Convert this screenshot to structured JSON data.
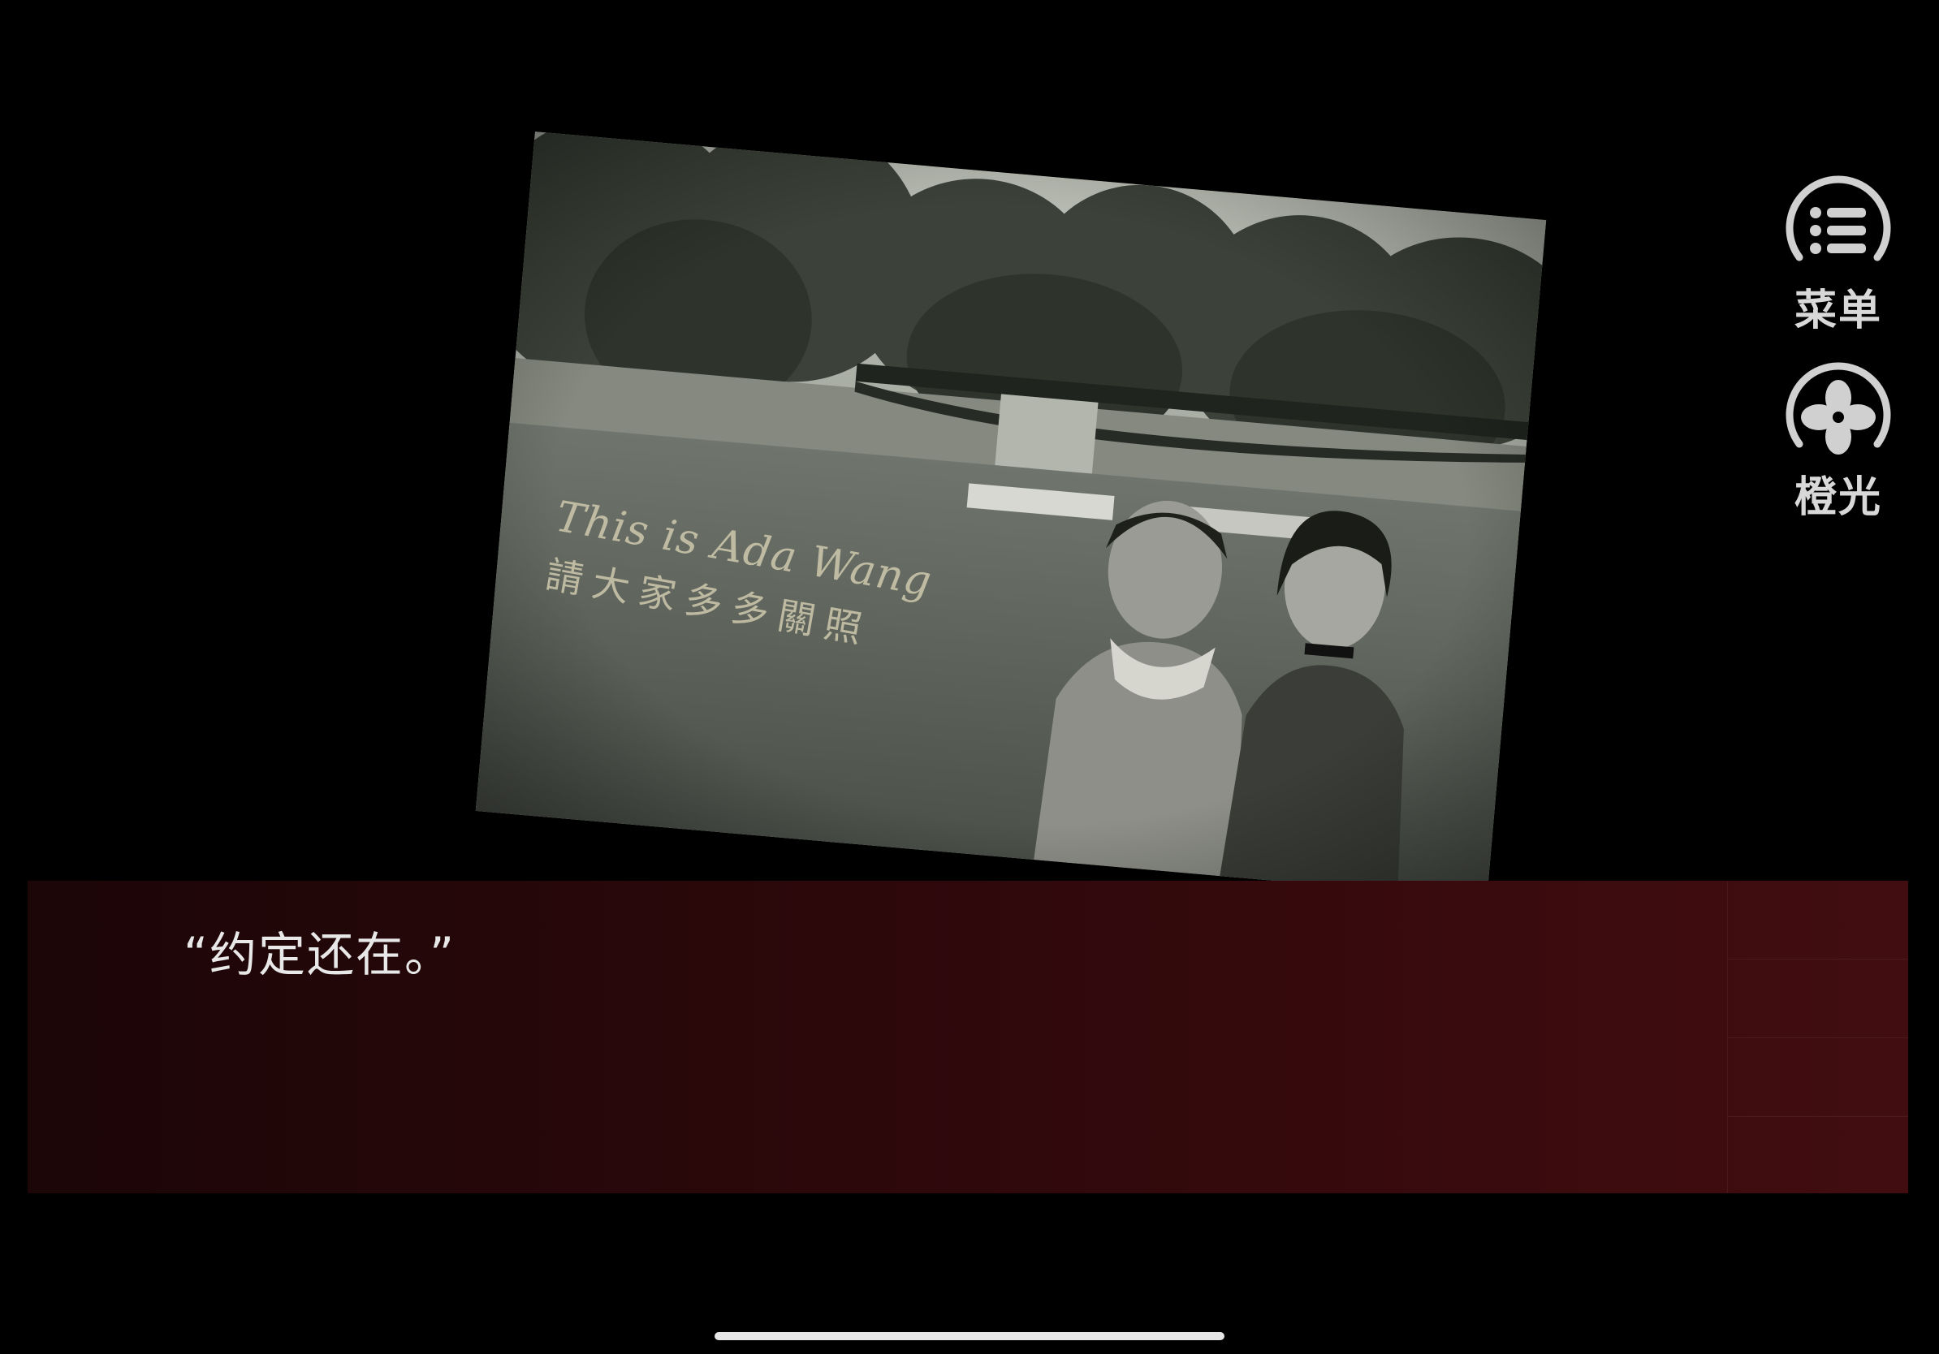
{
  "photo": {
    "caption_en": "This is Ada Wang",
    "caption_zh": "請大家多多關照"
  },
  "side_menu": {
    "menu_label": "菜单",
    "light_label": "橙光"
  },
  "dialog": {
    "text": "“约定还在。”"
  },
  "colors": {
    "background": "#000000",
    "dialog_left": "#1c0607",
    "dialog_right": "#420d10",
    "caption": "#c9c4a9"
  }
}
